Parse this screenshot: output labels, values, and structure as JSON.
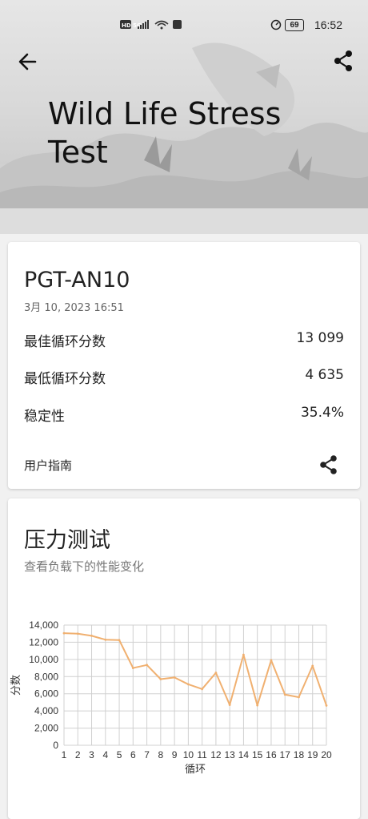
{
  "status_bar": {
    "network": "HD 5G",
    "battery": "69",
    "time": "16:52"
  },
  "header": {
    "title": "Wild Life Stress Test"
  },
  "result": {
    "device": "PGT-AN10",
    "date": "3月 10, 2023 16:51",
    "rows": [
      {
        "label": "最佳循环分数",
        "value": "13 099"
      },
      {
        "label": "最低循环分数",
        "value": "4 635"
      },
      {
        "label": "稳定性",
        "value": "35.4%"
      }
    ],
    "guide_label": "用户指南"
  },
  "stress": {
    "title": "压力测试",
    "subtitle": "查看负载下的性能变化"
  },
  "chart_data": {
    "type": "line",
    "xlabel": "循环",
    "ylabel": "分数",
    "ylim": [
      0,
      14000
    ],
    "yticks": [
      "0",
      "2,000",
      "4,000",
      "6,000",
      "8,000",
      "10,000",
      "12,000",
      "14,000"
    ],
    "x": [
      1,
      2,
      3,
      4,
      5,
      6,
      7,
      8,
      9,
      10,
      11,
      12,
      13,
      14,
      15,
      16,
      17,
      18,
      19,
      20
    ],
    "series": [
      {
        "values": [
          13050,
          13000,
          12750,
          12300,
          12250,
          9000,
          9350,
          7700,
          7900,
          7100,
          6550,
          8450,
          4700,
          10550,
          4650,
          9900,
          5900,
          5600,
          9250,
          4635
        ]
      }
    ],
    "grid": true,
    "line_color": "#f0b070",
    "grid_color": "#d0d0d0"
  }
}
